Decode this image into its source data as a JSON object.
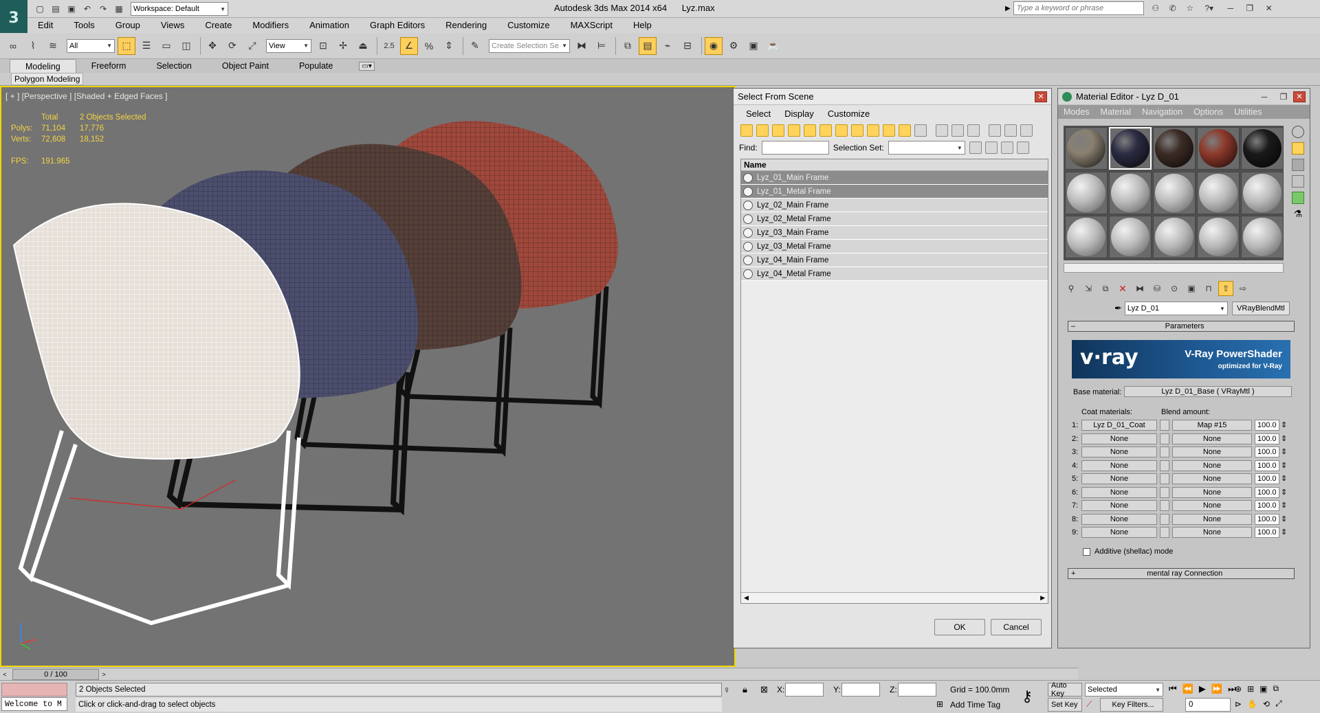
{
  "titlebar": {
    "workspace": "Workspace: Default",
    "title": "Autodesk 3ds Max  2014 x64",
    "file": "Lyz.max",
    "search_placeholder": "Type a keyword or phrase"
  },
  "menu": [
    "Edit",
    "Tools",
    "Group",
    "Views",
    "Create",
    "Modifiers",
    "Animation",
    "Graph Editors",
    "Rendering",
    "Customize",
    "MAXScript",
    "Help"
  ],
  "toolbar": {
    "filter_value": "All",
    "ref_coord_value": "View",
    "snap_label": "2.5",
    "selection_set_placeholder": "Create Selection Se"
  },
  "ribbon": {
    "tabs": [
      "Modeling",
      "Freeform",
      "Selection",
      "Object Paint",
      "Populate"
    ],
    "panel": "Polygon Modeling"
  },
  "viewport": {
    "label": "[ + ] [Perspective ] [Shaded + Edged Faces ]",
    "stats": {
      "total_label": "Total",
      "selected_label": "2 Objects Selected",
      "polys_label": "Polys:",
      "polys_total": "71,104",
      "polys_sel": "17,776",
      "verts_label": "Verts:",
      "verts_total": "72,608",
      "verts_sel": "18,152",
      "fps_label": "FPS:",
      "fps_value": "191.965"
    },
    "chair_colors": [
      "#e6dfd8",
      "#4c4e6e",
      "#553f38",
      "#a0483c"
    ]
  },
  "select_dialog": {
    "title": "Select From Scene",
    "menu": [
      "Select",
      "Display",
      "Customize"
    ],
    "find_label": "Find:",
    "selection_set_label": "Selection Set:",
    "column_name": "Name",
    "items": [
      {
        "name": "Lyz_01_Main Frame",
        "selected": true
      },
      {
        "name": "Lyz_01_Metal Frame",
        "selected": true
      },
      {
        "name": "Lyz_02_Main Frame",
        "selected": false
      },
      {
        "name": "Lyz_02_Metal Frame",
        "selected": false
      },
      {
        "name": "Lyz_03_Main Frame",
        "selected": false
      },
      {
        "name": "Lyz_03_Metal Frame",
        "selected": false
      },
      {
        "name": "Lyz_04_Main Frame",
        "selected": false
      },
      {
        "name": "Lyz_04_Metal Frame",
        "selected": false
      }
    ],
    "ok": "OK",
    "cancel": "Cancel"
  },
  "material_editor": {
    "title": "Material Editor - Lyz D_01",
    "menu": [
      "Modes",
      "Material",
      "Navigation",
      "Options",
      "Utilities"
    ],
    "sample_slot_colors": [
      "#8a8070",
      "#2c2c44",
      "#3d2c26",
      "#8f3a2c",
      "#1a1a1a"
    ],
    "material_name": "Lyz D_01",
    "material_type": "VRayBlendMtl",
    "rollout_parameters": "Parameters",
    "vray_logo": "v·ray",
    "vray_title": "V-Ray PowerShader",
    "vray_subtitle": "optimized for V-Ray",
    "base_material_label": "Base material:",
    "base_material_value": "Lyz D_01_Base  ( VRayMtl )",
    "coat_label": "Coat materials:",
    "blend_label": "Blend amount:",
    "coats": [
      {
        "idx": "1:",
        "coat": "Lyz D_01_Coat",
        "blend": "Map #15",
        "amount": "100.0"
      },
      {
        "idx": "2:",
        "coat": "None",
        "blend": "None",
        "amount": "100.0"
      },
      {
        "idx": "3:",
        "coat": "None",
        "blend": "None",
        "amount": "100.0"
      },
      {
        "idx": "4:",
        "coat": "None",
        "blend": "None",
        "amount": "100.0"
      },
      {
        "idx": "5:",
        "coat": "None",
        "blend": "None",
        "amount": "100.0"
      },
      {
        "idx": "6:",
        "coat": "None",
        "blend": "None",
        "amount": "100.0"
      },
      {
        "idx": "7:",
        "coat": "None",
        "blend": "None",
        "amount": "100.0"
      },
      {
        "idx": "8:",
        "coat": "None",
        "blend": "None",
        "amount": "100.0"
      },
      {
        "idx": "9:",
        "coat": "None",
        "blend": "None",
        "amount": "100.0"
      }
    ],
    "additive_label": "Additive (shellac) mode",
    "rollout_mental_ray": "mental ray Connection"
  },
  "timeline": {
    "frame": "0 / 100"
  },
  "status": {
    "maxscript": "Welcome to M",
    "selection": "2 Objects Selected",
    "prompt": "Click or click-and-drag to select objects",
    "x_label": "X:",
    "y_label": "Y:",
    "z_label": "Z:",
    "grid": "Grid = 100.0mm",
    "add_time_tag": "Add Time Tag",
    "auto_key": "Auto Key",
    "set_key": "Set Key",
    "key_mode": "Selected",
    "key_filters": "Key Filters...",
    "current_frame": "0"
  }
}
